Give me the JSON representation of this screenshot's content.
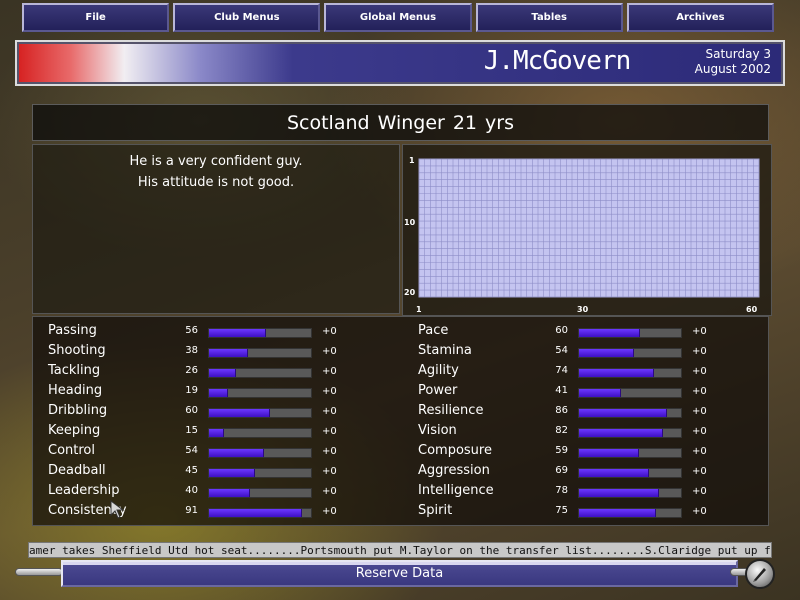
{
  "menu": {
    "items": [
      {
        "label": "File"
      },
      {
        "label": "Club Menus"
      },
      {
        "label": "Global Menus"
      },
      {
        "label": "Tables"
      },
      {
        "label": "Archives"
      }
    ]
  },
  "header": {
    "player_name": "J.McGovern",
    "date_line1": "Saturday 3",
    "date_line2": "August 2002"
  },
  "subtitle": {
    "nation": "Scotland",
    "position": "Winger",
    "age": "21 yrs"
  },
  "description": {
    "line1": "He is a very confident guy.",
    "line2": "His attitude is not good."
  },
  "grid": {
    "y_ticks": [
      "1",
      "10",
      "20"
    ],
    "x_ticks": [
      "1",
      "30",
      "60"
    ]
  },
  "attributes_left": [
    {
      "name": "Passing",
      "value": 56,
      "change": "+0"
    },
    {
      "name": "Shooting",
      "value": 38,
      "change": "+0"
    },
    {
      "name": "Tackling",
      "value": 26,
      "change": "+0"
    },
    {
      "name": "Heading",
      "value": 19,
      "change": "+0"
    },
    {
      "name": "Dribbling",
      "value": 60,
      "change": "+0"
    },
    {
      "name": "Keeping",
      "value": 15,
      "change": "+0"
    },
    {
      "name": "Control",
      "value": 54,
      "change": "+0"
    },
    {
      "name": "Deadball",
      "value": 45,
      "change": "+0"
    },
    {
      "name": "Leadership",
      "value": 40,
      "change": "+0"
    },
    {
      "name": "Consistency",
      "value": 91,
      "change": "+0"
    }
  ],
  "attributes_right": [
    {
      "name": "Pace",
      "value": 60,
      "change": "+0"
    },
    {
      "name": "Stamina",
      "value": 54,
      "change": "+0"
    },
    {
      "name": "Agility",
      "value": 74,
      "change": "+0"
    },
    {
      "name": "Power",
      "value": 41,
      "change": "+0"
    },
    {
      "name": "Resilience",
      "value": 86,
      "change": "+0"
    },
    {
      "name": "Vision",
      "value": 82,
      "change": "+0"
    },
    {
      "name": "Composure",
      "value": 59,
      "change": "+0"
    },
    {
      "name": "Aggression",
      "value": 69,
      "change": "+0"
    },
    {
      "name": "Intelligence",
      "value": 78,
      "change": "+0"
    },
    {
      "name": "Spirit",
      "value": 75,
      "change": "+0"
    }
  ],
  "ticker": {
    "text": "amer takes Sheffield Utd hot seat........Portsmouth put M.Taylor on the transfer list........S.Claridge put up for sale........Rochdale p"
  },
  "footer": {
    "button_label": "Reserve Data",
    "knob_icon": "pen-nib-icon"
  },
  "colors": {
    "bar_fill": "#5a24f0",
    "bar_track": "#595959",
    "grid_fill": "#c4c4f0",
    "menu_bg": "#2e2c6c"
  }
}
